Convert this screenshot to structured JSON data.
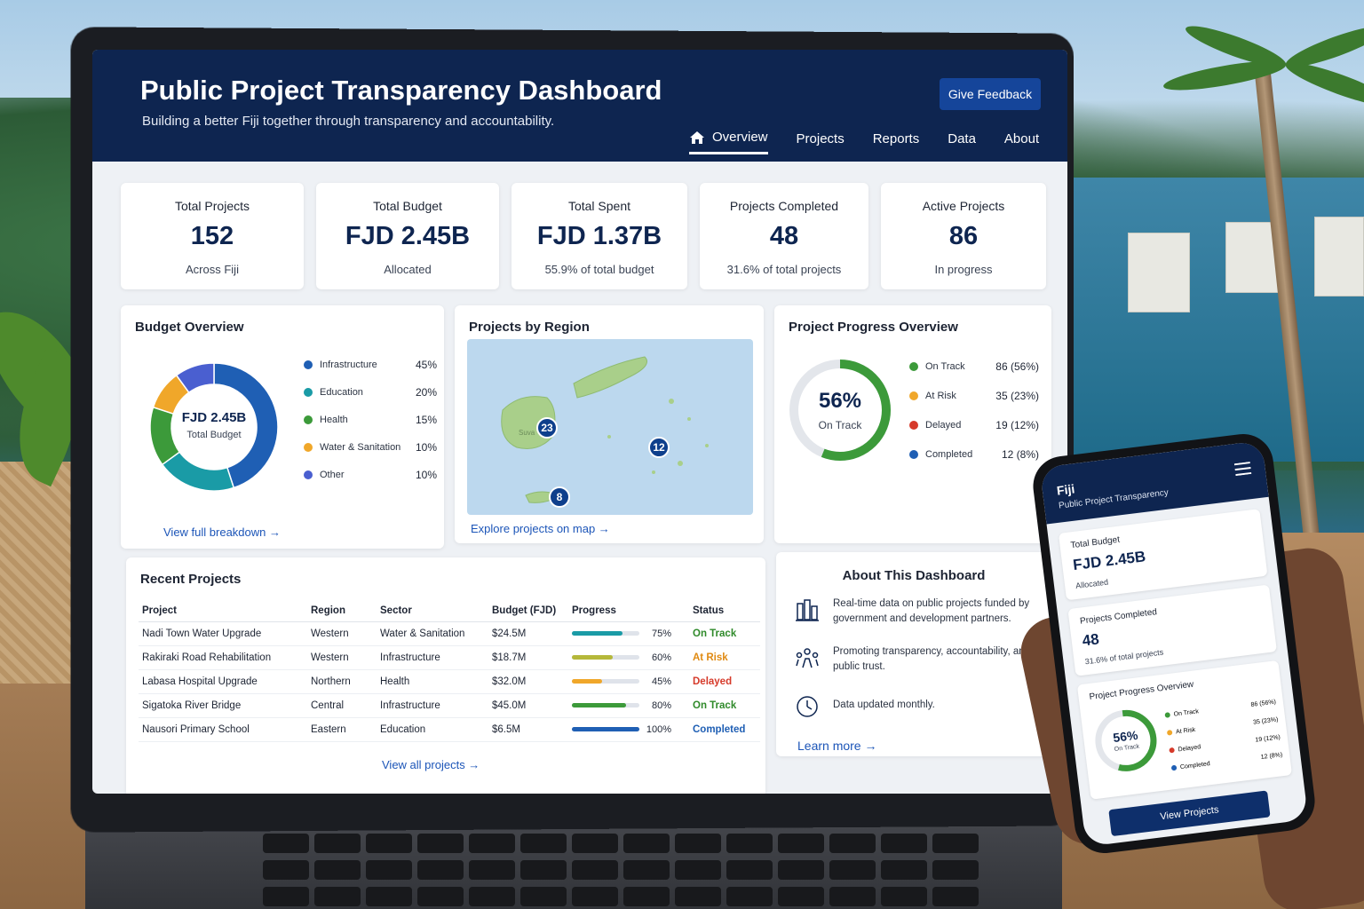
{
  "header": {
    "title": "Public Project Transparency Dashboard",
    "subtitle": "Building a better Fiji together through transparency and accountability.",
    "feedback_label": "Give Feedback",
    "nav": [
      "Overview",
      "Projects",
      "Reports",
      "Data",
      "About"
    ]
  },
  "kpis": [
    {
      "label": "Total Projects",
      "value": "152",
      "note": "Across Fiji"
    },
    {
      "label": "Total Budget",
      "value": "FJD 2.45B",
      "note": "Allocated"
    },
    {
      "label": "Total Spent",
      "value": "FJD 1.37B",
      "note": "55.9% of total budget"
    },
    {
      "label": "Projects Completed",
      "value": "48",
      "note": "31.6% of total projects"
    },
    {
      "label": "Active Projects",
      "value": "86",
      "note": "In progress"
    }
  ],
  "budget": {
    "title": "Budget Overview",
    "center_value": "FJD 2.45B",
    "center_label": "Total Budget",
    "link": "View full breakdown →",
    "items": [
      {
        "label": "Infrastructure",
        "value": "45%",
        "color": "#1f5fb4"
      },
      {
        "label": "Education",
        "value": "20%",
        "color": "#1a9ba6"
      },
      {
        "label": "Health",
        "value": "15%",
        "color": "#3c9a3a"
      },
      {
        "label": "Water & Sanitation",
        "value": "10%",
        "color": "#f0a72a"
      },
      {
        "label": "Other",
        "value": "10%",
        "color": "#4a5fd0"
      }
    ]
  },
  "region": {
    "title": "Projects by Region",
    "link": "Explore projects on map →",
    "pins": [
      "23",
      "12",
      "8"
    ],
    "map_label": "Suva"
  },
  "progress": {
    "title": "Project Progress Overview",
    "center_value": "56%",
    "center_label": "On Track",
    "items": [
      {
        "label": "On Track",
        "value": "86",
        "pct": "(56%)",
        "color": "#3c9a3a"
      },
      {
        "label": "At Risk",
        "value": "35",
        "pct": "(23%)",
        "color": "#f0a72a"
      },
      {
        "label": "Delayed",
        "value": "19",
        "pct": "(12%)",
        "color": "#d63a2a"
      },
      {
        "label": "Completed",
        "value": "12",
        "pct": "(8%)",
        "color": "#1f5fb4"
      }
    ]
  },
  "recent": {
    "title": "Recent Projects",
    "columns": [
      "Project",
      "Region",
      "Sector",
      "Budget (FJD)",
      "Progress",
      "Status"
    ],
    "rows": [
      {
        "project": "Nadi Town Water Upgrade",
        "region": "Western",
        "sector": "Water & Sanitation",
        "budget": "$24.5M",
        "progress": "75%",
        "progress_value": 0.75,
        "status": "On Track",
        "color": "#1a9ba6",
        "status_color": "#2f8a2a"
      },
      {
        "project": "Rakiraki Road Rehabilitation",
        "region": "Western",
        "sector": "Infrastructure",
        "budget": "$18.7M",
        "progress": "60%",
        "progress_value": 0.6,
        "status": "At Risk",
        "color": "#b5b83a",
        "status_color": "#e08a12"
      },
      {
        "project": "Labasa Hospital Upgrade",
        "region": "Northern",
        "sector": "Health",
        "budget": "$32.0M",
        "progress": "45%",
        "progress_value": 0.45,
        "status": "Delayed",
        "color": "#f0a72a",
        "status_color": "#d63a2a"
      },
      {
        "project": "Sigatoka River Bridge",
        "region": "Central",
        "sector": "Infrastructure",
        "budget": "$45.0M",
        "progress": "80%",
        "progress_value": 0.8,
        "status": "On Track",
        "color": "#3c9a3a",
        "status_color": "#2f8a2a"
      },
      {
        "project": "Nausori Primary School",
        "region": "Eastern",
        "sector": "Education",
        "budget": "$6.5M",
        "progress": "100%",
        "progress_value": 1.0,
        "status": "Completed",
        "color": "#1f5fb4",
        "status_color": "#1f5fb4"
      }
    ],
    "link": "View all projects →"
  },
  "about": {
    "title": "About This Dashboard",
    "items": [
      {
        "text": "Real-time data on public projects funded by government and development partners.",
        "icon": "building-chart-icon"
      },
      {
        "text": "Promoting transparency, accountability, and public trust.",
        "icon": "people-network-icon"
      },
      {
        "text": "Data updated monthly.",
        "icon": "clock-icon"
      }
    ],
    "link": "Learn more →"
  },
  "phone": {
    "brand": "Fiji",
    "subtitle": "Public Project Transparency",
    "budget_label": "Total Budget",
    "budget_value": "FJD 2.45B",
    "budget_note": "Allocated",
    "completed_label": "Projects Completed",
    "completed_value": "48",
    "completed_note": "31.6% of total projects",
    "progress_title": "Project Progress Overview",
    "progress_center": "56%",
    "progress_center_label": "On Track",
    "progress_items": [
      {
        "label": "On Track",
        "value": "86 (56%)",
        "color": "#3c9a3a"
      },
      {
        "label": "At Risk",
        "value": "35 (23%)",
        "color": "#f0a72a"
      },
      {
        "label": "Delayed",
        "value": "19 (12%)",
        "color": "#d63a2a"
      },
      {
        "label": "Completed",
        "value": "12 (8%)",
        "color": "#1f5fb4"
      }
    ],
    "button": "View Projects"
  }
}
